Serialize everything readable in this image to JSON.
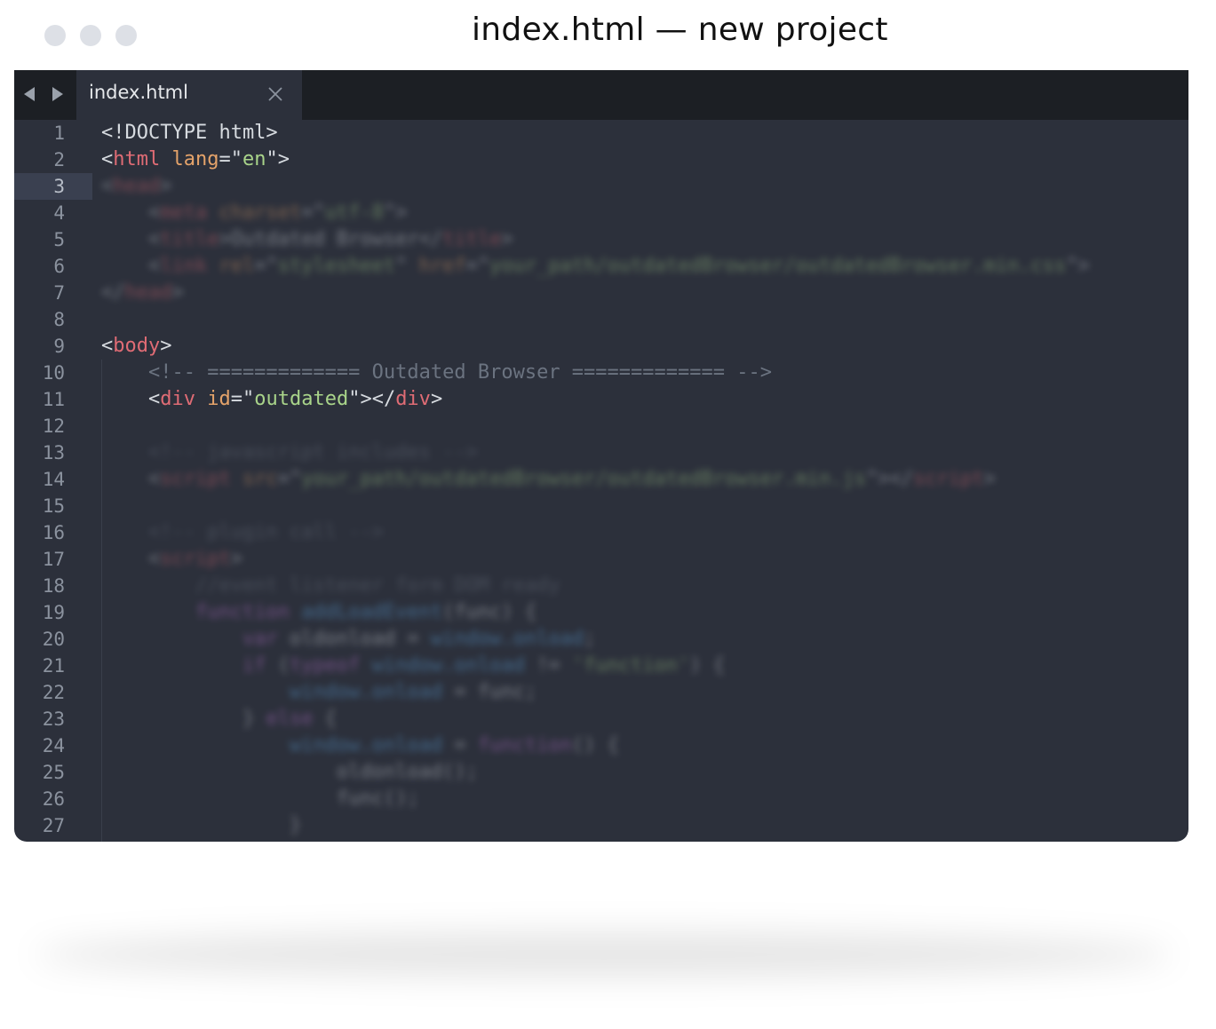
{
  "window": {
    "title": "index.html — new project"
  },
  "tabbar": {
    "back_icon": "triangle-left",
    "forward_icon": "triangle-right",
    "tabs": [
      {
        "label": "index.html",
        "close_icon": "close-x"
      }
    ]
  },
  "editor": {
    "current_line": 3,
    "line_numbers": [
      "1",
      "2",
      "3",
      "4",
      "5",
      "6",
      "7",
      "8",
      "9",
      "10",
      "11",
      "12",
      "13",
      "14",
      "15",
      "16",
      "17",
      "18",
      "19",
      "20",
      "21",
      "22",
      "23",
      "24",
      "25",
      "26",
      "27"
    ],
    "lines": [
      {
        "segments": [
          {
            "t": "pun",
            "text": "<!DOCTYPE html>"
          }
        ]
      },
      {
        "segments": [
          {
            "t": "pun",
            "text": "<"
          },
          {
            "t": "tag",
            "text": "html"
          },
          {
            "t": "pun",
            "text": " "
          },
          {
            "t": "attr",
            "text": "lang"
          },
          {
            "t": "pun",
            "text": "=\""
          },
          {
            "t": "val",
            "text": "en"
          },
          {
            "t": "pun",
            "text": "\">"
          }
        ]
      },
      {
        "blurred": true,
        "segments": [
          {
            "t": "pun",
            "text": "<"
          },
          {
            "t": "tag",
            "text": "head"
          },
          {
            "t": "pun",
            "text": ">"
          }
        ]
      },
      {
        "blurred": true,
        "segments": [
          {
            "t": "pun",
            "text": "    <"
          },
          {
            "t": "tag",
            "text": "meta"
          },
          {
            "t": "pun",
            "text": " "
          },
          {
            "t": "attr",
            "text": "charset"
          },
          {
            "t": "pun",
            "text": "=\""
          },
          {
            "t": "val",
            "text": "utf-8"
          },
          {
            "t": "pun",
            "text": "\">"
          }
        ]
      },
      {
        "blurred": true,
        "segments": [
          {
            "t": "pun",
            "text": "    <"
          },
          {
            "t": "tag",
            "text": "title"
          },
          {
            "t": "pun",
            "text": ">Outdated Browser</"
          },
          {
            "t": "tag",
            "text": "title"
          },
          {
            "t": "pun",
            "text": ">"
          }
        ]
      },
      {
        "blurred": true,
        "segments": [
          {
            "t": "pun",
            "text": "    <"
          },
          {
            "t": "tag",
            "text": "link"
          },
          {
            "t": "pun",
            "text": " "
          },
          {
            "t": "attr",
            "text": "rel"
          },
          {
            "t": "pun",
            "text": "=\""
          },
          {
            "t": "val",
            "text": "stylesheet"
          },
          {
            "t": "pun",
            "text": "\" "
          },
          {
            "t": "attr",
            "text": "href"
          },
          {
            "t": "pun",
            "text": "=\""
          },
          {
            "t": "val",
            "text": "your_path/outdatedBrowser/outdatedBrowser.min.css"
          },
          {
            "t": "pun",
            "text": "\">"
          }
        ]
      },
      {
        "blurred": true,
        "segments": [
          {
            "t": "pun",
            "text": "</"
          },
          {
            "t": "tag",
            "text": "head"
          },
          {
            "t": "pun",
            "text": ">"
          }
        ]
      },
      {
        "segments": []
      },
      {
        "segments": [
          {
            "t": "pun",
            "text": "<"
          },
          {
            "t": "tag",
            "text": "body"
          },
          {
            "t": "pun",
            "text": ">"
          }
        ]
      },
      {
        "segments": [
          {
            "t": "com",
            "text": "    <!-- ============= Outdated Browser ============= -->"
          }
        ]
      },
      {
        "segments": [
          {
            "t": "pun",
            "text": "    <"
          },
          {
            "t": "tag",
            "text": "div"
          },
          {
            "t": "pun",
            "text": " "
          },
          {
            "t": "attr",
            "text": "id"
          },
          {
            "t": "pun",
            "text": "=\""
          },
          {
            "t": "val",
            "text": "outdated"
          },
          {
            "t": "pun",
            "text": "\"></"
          },
          {
            "t": "tag",
            "text": "div"
          },
          {
            "t": "pun",
            "text": ">"
          }
        ]
      },
      {
        "segments": []
      },
      {
        "blurred": true,
        "segments": [
          {
            "t": "com",
            "text": "    <!-- javascript includes -->"
          }
        ]
      },
      {
        "blurred": true,
        "segments": [
          {
            "t": "pun",
            "text": "    <"
          },
          {
            "t": "tag",
            "text": "script"
          },
          {
            "t": "pun",
            "text": " "
          },
          {
            "t": "attr",
            "text": "src"
          },
          {
            "t": "pun",
            "text": "=\""
          },
          {
            "t": "val",
            "text": "your_path/outdatedBrowser/outdatedBrowser.min.js"
          },
          {
            "t": "pun",
            "text": "\"></"
          },
          {
            "t": "tag",
            "text": "script"
          },
          {
            "t": "pun",
            "text": ">"
          }
        ]
      },
      {
        "segments": []
      },
      {
        "blurred": true,
        "segments": [
          {
            "t": "com",
            "text": "    <!-- plugin call -->"
          }
        ]
      },
      {
        "blurred": true,
        "segments": [
          {
            "t": "pun",
            "text": "    <"
          },
          {
            "t": "tag",
            "text": "script"
          },
          {
            "t": "pun",
            "text": ">"
          }
        ]
      },
      {
        "blurred": true,
        "segments": [
          {
            "t": "com",
            "text": "        //event listener form DOM ready"
          }
        ]
      },
      {
        "blurred": true,
        "segments": [
          {
            "t": "kw",
            "text": "        function "
          },
          {
            "t": "fn",
            "text": "addLoadEvent"
          },
          {
            "t": "pun",
            "text": "(func) {"
          }
        ]
      },
      {
        "blurred": true,
        "segments": [
          {
            "t": "kw",
            "text": "            var "
          },
          {
            "t": "pun",
            "text": "oldonload = "
          },
          {
            "t": "fn",
            "text": "window.onload"
          },
          {
            "t": "pun",
            "text": ";"
          }
        ]
      },
      {
        "blurred": true,
        "segments": [
          {
            "t": "kw",
            "text": "            if "
          },
          {
            "t": "pun",
            "text": "("
          },
          {
            "t": "kw",
            "text": "typeof "
          },
          {
            "t": "fn",
            "text": "window.onload"
          },
          {
            "t": "pun",
            "text": " != "
          },
          {
            "t": "val",
            "text": "'function'"
          },
          {
            "t": "pun",
            "text": ") {"
          }
        ]
      },
      {
        "blurred": true,
        "segments": [
          {
            "t": "fn",
            "text": "                window.onload"
          },
          {
            "t": "pun",
            "text": " = func;"
          }
        ]
      },
      {
        "blurred": true,
        "segments": [
          {
            "t": "pun",
            "text": "            } "
          },
          {
            "t": "kw",
            "text": "else"
          },
          {
            "t": "pun",
            "text": " {"
          }
        ]
      },
      {
        "blurred": true,
        "segments": [
          {
            "t": "fn",
            "text": "                window.onload"
          },
          {
            "t": "pun",
            "text": " = "
          },
          {
            "t": "kw",
            "text": "function"
          },
          {
            "t": "pun",
            "text": "() {"
          }
        ]
      },
      {
        "blurred": true,
        "segments": [
          {
            "t": "pun",
            "text": "                    oldonload();"
          }
        ]
      },
      {
        "blurred": true,
        "segments": [
          {
            "t": "pun",
            "text": "                    func();"
          }
        ]
      },
      {
        "blurred": true,
        "segments": [
          {
            "t": "pun",
            "text": "                }"
          }
        ]
      }
    ]
  },
  "colors": {
    "editor_bg": "#2c303b",
    "tabbar_bg": "#1c1f24",
    "tag": "#e06c75",
    "attr": "#e5a36a",
    "string": "#a9d48a",
    "comment": "#6b7380",
    "text": "#d7dbe0"
  }
}
